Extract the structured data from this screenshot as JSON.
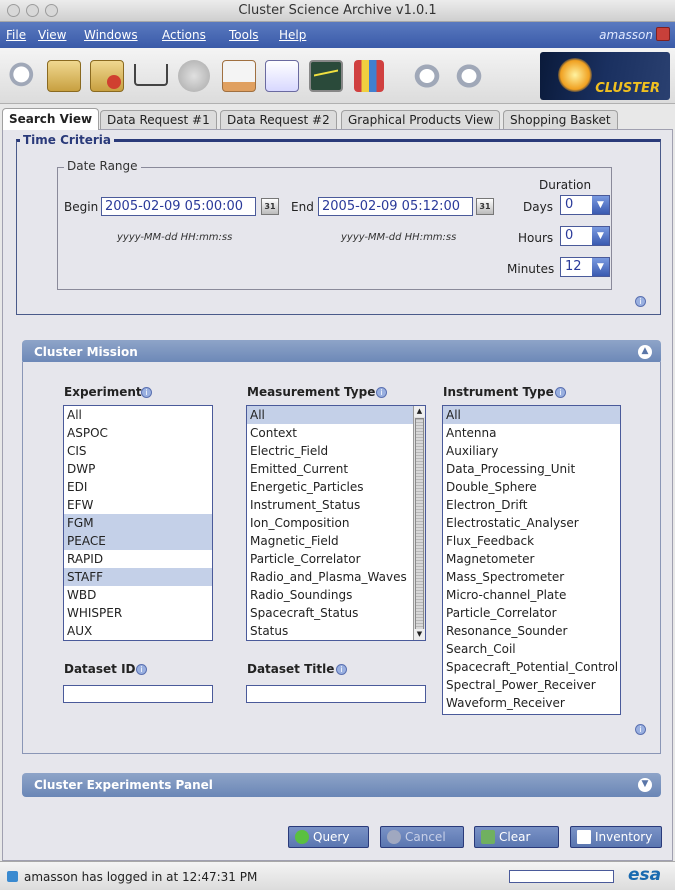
{
  "window": {
    "title": "Cluster Science Archive v1.0.1"
  },
  "menu": {
    "items": [
      "File",
      "View",
      "Windows",
      "Actions",
      "Tools",
      "Help"
    ],
    "user": "amasson"
  },
  "toolbar": {
    "icons": [
      "search-zoom-icon",
      "notes-icon",
      "cancel-document-icon",
      "cart-icon",
      "stop-icon",
      "calendar-icon",
      "edit-icon",
      "graph-icon",
      "bars-icon",
      "back-search-icon",
      "forward-search-icon"
    ],
    "logo_text": "CLUSTER"
  },
  "tabs": [
    "Search View",
    "Data Request #1",
    "Data Request #2",
    "Graphical Products View",
    "Shopping Basket"
  ],
  "time_criteria": {
    "title": "Time Criteria",
    "date_range_title": "Date Range",
    "begin_label": "Begin",
    "begin_value": "2005-02-09 05:00:00",
    "end_label": "End",
    "end_value": "2005-02-09 05:12:00",
    "calendar_label": "31",
    "format_hint": "yyyy-MM-dd HH:mm:ss",
    "duration_label": "Duration",
    "days_label": "Days",
    "days_value": "0",
    "hours_label": "Hours",
    "hours_value": "0",
    "minutes_label": "Minutes",
    "minutes_value": "12"
  },
  "mission": {
    "title": "Cluster Mission",
    "experiment_label": "Experiment",
    "experiments": [
      "All",
      "ASPOC",
      "CIS",
      "DWP",
      "EDI",
      "EFW",
      "FGM",
      "PEACE",
      "RAPID",
      "STAFF",
      "WBD",
      "WHISPER",
      "AUX"
    ],
    "experiments_selected": [
      "FGM",
      "PEACE",
      "STAFF"
    ],
    "measurement_label": "Measurement Type",
    "measurements": [
      "All",
      "Context",
      "Electric_Field",
      "Emitted_Current",
      "Energetic_Particles",
      "Instrument_Status",
      "Ion_Composition",
      "Magnetic_Field",
      "Particle_Correlator",
      "Radio_and_Plasma_Waves",
      "Radio_Soundings",
      "Spacecraft_Status",
      "Status"
    ],
    "measurements_selected": [
      "All"
    ],
    "instrument_label": "Instrument Type",
    "instruments": [
      "All",
      "Antenna",
      "Auxiliary",
      "Data_Processing_Unit",
      "Double_Sphere",
      "Electron_Drift",
      "Electrostatic_Analyser",
      "Flux_Feedback",
      "Magnetometer",
      "Mass_Spectrometer",
      "Micro-channel_Plate",
      "Particle_Correlator",
      "Resonance_Sounder",
      "Search_Coil",
      "Spacecraft_Potential_Control",
      "Spectral_Power_Receiver",
      "Waveform_Receiver"
    ],
    "instruments_selected": [
      "All"
    ],
    "dataset_id_label": "Dataset ID",
    "dataset_title_label": "Dataset Title"
  },
  "experiments_panel": {
    "title": "Cluster Experiments Panel"
  },
  "buttons": {
    "query": "Query",
    "cancel": "Cancel",
    "clear": "Clear",
    "inventory": "Inventory"
  },
  "status": {
    "message": "amasson has logged in at 12:47:31 PM",
    "logo": "esa"
  },
  "colors": {
    "menu": "#3a5aa8",
    "section": "#7a92c0",
    "selection": "#c4d0e8",
    "text_blue": "#2a3a9a"
  }
}
